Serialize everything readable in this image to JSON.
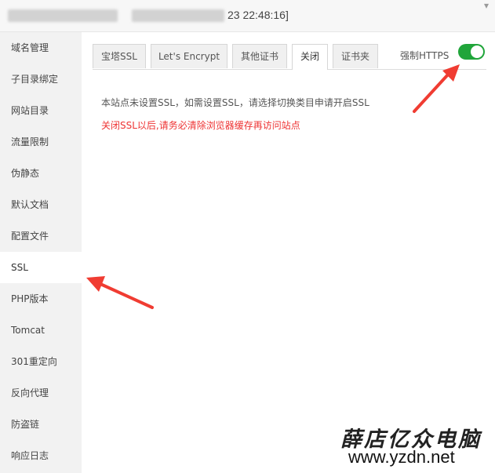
{
  "titlebar": {
    "timestamp": "23 22:48:16]"
  },
  "sidebar": {
    "items": [
      {
        "label": "域名管理"
      },
      {
        "label": "子目录绑定"
      },
      {
        "label": "网站目录"
      },
      {
        "label": "流量限制"
      },
      {
        "label": "伪静态"
      },
      {
        "label": "默认文档"
      },
      {
        "label": "配置文件"
      },
      {
        "label": "SSL"
      },
      {
        "label": "PHP版本"
      },
      {
        "label": "Tomcat"
      },
      {
        "label": "301重定向"
      },
      {
        "label": "反向代理"
      },
      {
        "label": "防盗链"
      },
      {
        "label": "响应日志"
      }
    ],
    "active_label": "SSL"
  },
  "tabs": [
    {
      "label": "宝塔SSL"
    },
    {
      "label": "Let's Encrypt"
    },
    {
      "label": "其他证书"
    },
    {
      "label": "关闭"
    },
    {
      "label": "证书夹"
    }
  ],
  "active_tab": "关闭",
  "force_https": {
    "label": "强制HTTPS",
    "enabled": true,
    "color": "#20a53a"
  },
  "content": {
    "message": "本站点未设置SSL，如需设置SSL，请选择切换类目申请开启SSL",
    "warning": "关闭SSL以后,请务必清除浏览器缓存再访问站点",
    "warning_color": "#ee3333"
  },
  "watermark": {
    "title": "薛店亿众电脑",
    "url": "www.yzdn.net"
  },
  "annotation_color": "#f03c32"
}
